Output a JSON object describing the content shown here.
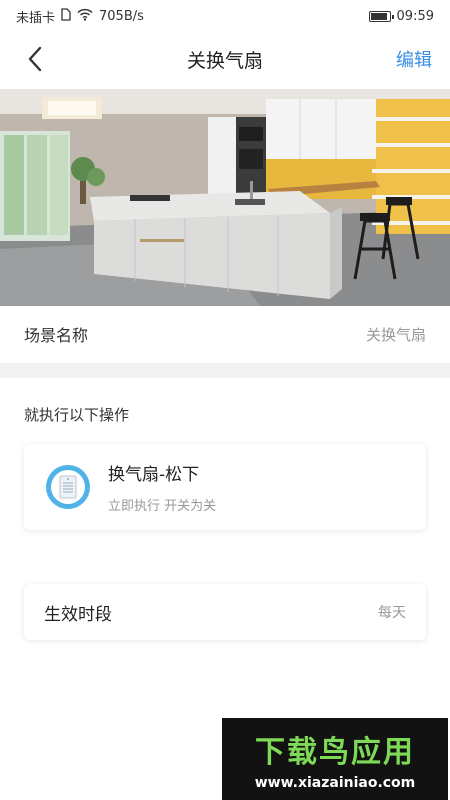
{
  "status_bar": {
    "carrier": "未插卡",
    "speed": "705B/s",
    "time": "09:59"
  },
  "header": {
    "title": "关换气扇",
    "edit_label": "编辑"
  },
  "scene": {
    "label": "场景名称",
    "value": "关换气扇"
  },
  "actions_section": {
    "title": "就执行以下操作",
    "items": [
      {
        "name": "换气扇-松下",
        "desc": "立即执行 开关为关",
        "icon": "ventilation-fan-icon"
      }
    ]
  },
  "effective_time": {
    "label": "生效时段",
    "value": "每天"
  },
  "watermark": {
    "logo": "下载鸟应用",
    "url": "www.xiazainiao.com"
  },
  "colors": {
    "accent": "#3a8ee6",
    "device_ring": "#4fb3e8",
    "band": "#f2f2f2"
  }
}
